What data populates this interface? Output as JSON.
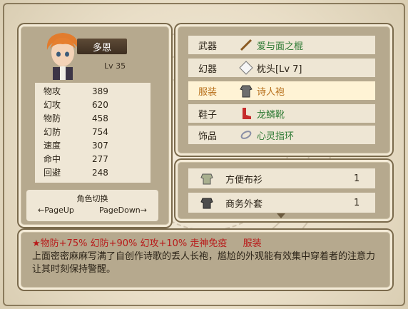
{
  "character": {
    "name": "多恩",
    "level": "Lv 35",
    "stats": [
      {
        "label": "物攻",
        "value": "389"
      },
      {
        "label": "幻攻",
        "value": "620"
      },
      {
        "label": "物防",
        "value": "458"
      },
      {
        "label": "幻防",
        "value": "754"
      },
      {
        "label": "速度",
        "value": "307"
      },
      {
        "label": "命中",
        "value": "277"
      },
      {
        "label": "回避",
        "value": "248"
      }
    ],
    "switch": {
      "title": "角色切换",
      "left": "←PageUp",
      "right": "PageDown→"
    }
  },
  "equipment": [
    {
      "slot": "武器",
      "icon": "staff-icon",
      "name": "爱与面之棍"
    },
    {
      "slot": "幻器",
      "icon": "diamond-icon",
      "name": "枕头[Lv 7]"
    },
    {
      "slot": "服装",
      "icon": "robe-icon",
      "name": "诗人袍"
    },
    {
      "slot": "鞋子",
      "icon": "boots-icon",
      "name": "龙鳞靴"
    },
    {
      "slot": "饰品",
      "icon": "ring-icon",
      "name": "心灵指环"
    }
  ],
  "inventory": [
    {
      "icon": "cloth-icon",
      "name": "方便布衫",
      "count": "1"
    },
    {
      "icon": "coat-icon",
      "name": "商务外套",
      "count": "1"
    }
  ],
  "description": {
    "effects": "★物防+75% 幻防+90% 幻攻+10% 走神免疫",
    "type": "服装",
    "text": "上面密密麻麻写满了自创作诗歌的丢人长袍，尴尬的外观能有效集中穿着者的注意力让其时刻保持警醒。"
  },
  "colors": {
    "panel": "#b6a98e",
    "row": "#eee6d4",
    "highlight": "#fff3d5",
    "green_text": "#2d7a33",
    "effect_red": "#b81a1a"
  }
}
